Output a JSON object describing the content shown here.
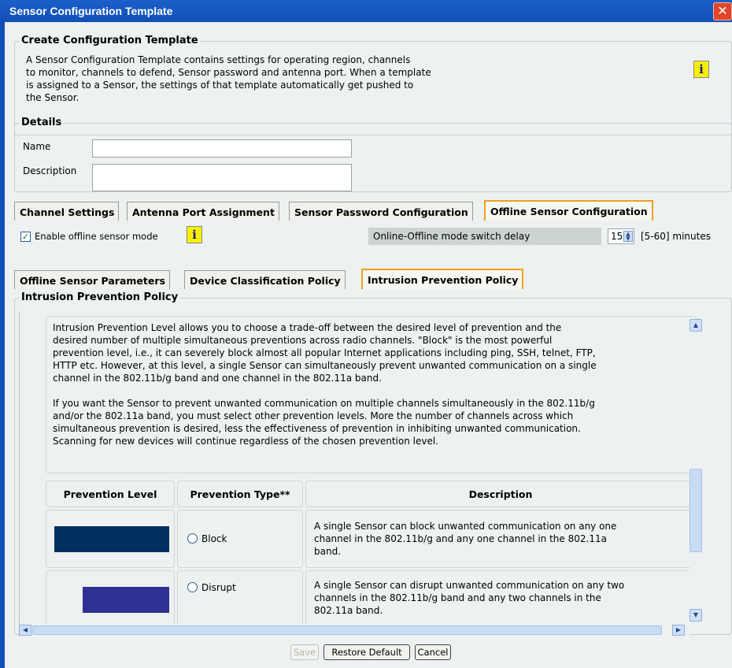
{
  "window": {
    "title": "Sensor Configuration Template"
  },
  "create_section": {
    "legend": "Create Configuration Template",
    "lines": [
      "A Sensor Configuration Template contains settings for operating region, channels",
      "to monitor, channels to defend, Sensor password and antenna port. When a template",
      "is assigned to a Sensor, the settings of that template automatically get pushed to",
      "the Sensor."
    ],
    "info_glyph": "i"
  },
  "details": {
    "legend": "Details",
    "name_label": "Name",
    "name_value": "",
    "description_label": "Description",
    "description_value": ""
  },
  "tabs": [
    {
      "label": "Channel Settings"
    },
    {
      "label": "Antenna Port Assignment"
    },
    {
      "label": "Sensor Password Configuration"
    },
    {
      "label": "Offline Sensor Configuration"
    }
  ],
  "offline": {
    "enable_label": "Enable offline sensor mode",
    "enable_checked": true,
    "delay_label": "Online-Offline mode switch delay",
    "delay_value": "15",
    "delay_range": "[5-60] minutes"
  },
  "subtabs": [
    {
      "label": "Offline Sensor Parameters"
    },
    {
      "label": "Device Classification Policy"
    },
    {
      "label": "Intrusion Prevention Policy"
    }
  ],
  "ipp": {
    "legend": "Intrusion Prevention Policy",
    "para1": [
      "Intrusion Prevention Level allows you to choose a trade-off between the desired level of prevention and the",
      "desired number of multiple simultaneous preventions across radio channels. \"Block\" is the most powerful",
      "prevention level, i.e., it can severely block almost all popular Internet applications including ping, SSH, telnet, FTP,",
      "HTTP etc. However, at this level, a single Sensor can simultaneously prevent unwanted communication on a single",
      "channel in the 802.11b/g band and one channel in the 802.11a band."
    ],
    "para2": [
      "If you want the Sensor to prevent unwanted communication on multiple channels simultaneously in the 802.11b/g",
      "and/or the 802.11a band, you must select other prevention levels. More the number of channels across which",
      "simultaneous prevention is desired, less the effectiveness of prevention in inhibiting unwanted communication.",
      "Scanning for new devices will continue regardless of the chosen prevention level."
    ],
    "table": {
      "headers": [
        "Prevention Level",
        "Prevention Type**",
        "Description"
      ],
      "rows": [
        {
          "level": 1.0,
          "color": "#00305e",
          "type": "Block",
          "desc_lines": [
            "A single Sensor can block unwanted communication on any one",
            "channel in the 802.11b/g and any one channel in the 802.11a",
            "band."
          ]
        },
        {
          "level": 0.75,
          "color": "#2e3191",
          "type": "Disrupt",
          "desc_lines": [
            "A single Sensor can disrupt unwanted communication on any two",
            "channels in the 802.11b/g band and any two channels in the",
            "802.11a band."
          ]
        }
      ]
    }
  },
  "buttons": {
    "save": "Save",
    "restore": "Restore Default",
    "cancel": "Cancel"
  },
  "colors": {
    "titlebar": "#1050b8",
    "active_tab_border": "#f0a020",
    "info_icon": "#f6f000",
    "panel_bg": "#eef1f1"
  }
}
